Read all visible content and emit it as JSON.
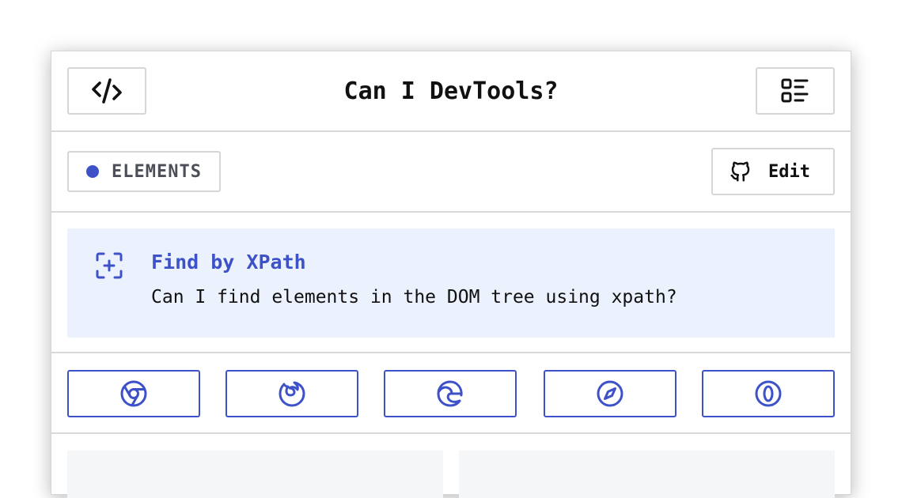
{
  "header": {
    "title": "Can I DevTools?",
    "left_icon": "code-icon",
    "right_icon": "list-icon"
  },
  "category": {
    "label": "ELEMENTS",
    "dot_color": "#3d52c8",
    "edit_label": "Edit",
    "edit_icon": "github-icon"
  },
  "feature": {
    "icon": "focus-add-icon",
    "title": "Find by XPath",
    "description": "Can I find elements in the DOM tree using xpath?",
    "background": "#ebf1fd",
    "accent": "#3d52c8"
  },
  "browsers": [
    {
      "name": "chrome",
      "icon": "chrome-icon"
    },
    {
      "name": "firefox",
      "icon": "firefox-icon"
    },
    {
      "name": "edge",
      "icon": "edge-icon"
    },
    {
      "name": "safari",
      "icon": "safari-icon"
    },
    {
      "name": "opera",
      "icon": "opera-icon"
    }
  ]
}
